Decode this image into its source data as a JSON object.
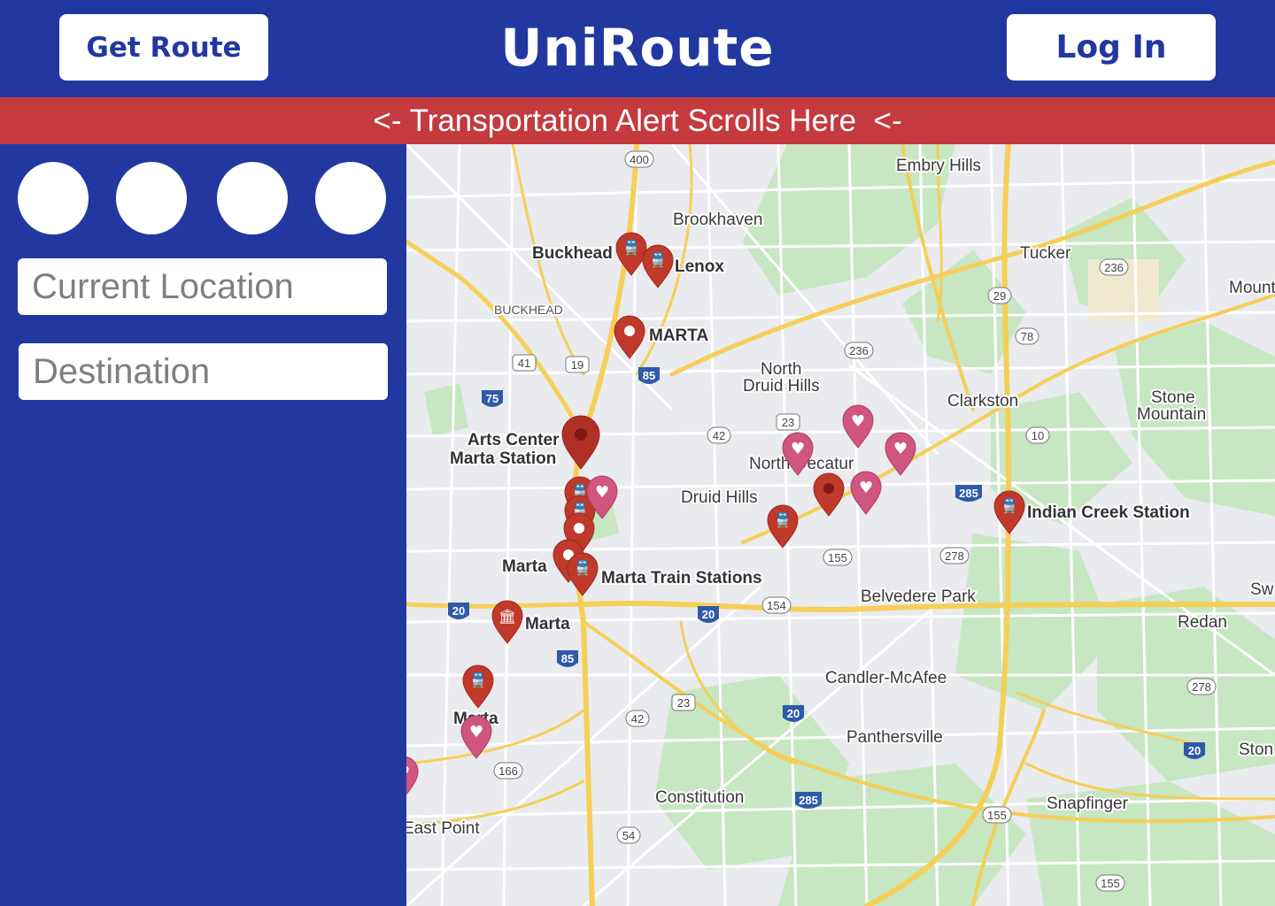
{
  "header": {
    "get_route_label": "Get Route",
    "title": "UniRoute",
    "login_label": "Log In"
  },
  "alert": {
    "text": "<- Transportation Alert Scrolls Here  <-"
  },
  "sidebar": {
    "current_location_placeholder": "Current Location",
    "destination_placeholder": "Destination"
  },
  "map": {
    "places": {
      "embry_hills": "Embry Hills",
      "brookhaven": "Brookhaven",
      "buckhead": "Buckhead",
      "lenox": "Lenox",
      "buckhead_area": "BUCKHEAD",
      "marta_top": "MARTA",
      "tucker": "Tucker",
      "mount": "Mount",
      "north_druid_hills_1": "North",
      "north_druid_hills_2": "Druid Hills",
      "clarkston": "Clarkston",
      "stone_mountain_1": "Stone",
      "stone_mountain_2": "Mountain",
      "arts_center_1": "Arts Center",
      "arts_center_2": "Marta Station",
      "north_decatur": "North Decatur",
      "druid_hills": "Druid Hills",
      "indian_creek": "Indian Creek Station",
      "marta_mid": "Marta",
      "marta_train_stations": "Marta Train Stations",
      "belvedere_park": "Belvedere Park",
      "marta_museum": "Marta",
      "redan": "Redan",
      "sw": "Sw",
      "candler_mcafee": "Candler-McAfee",
      "marta_low": "Marta",
      "panthersville": "Panthersville",
      "ston": "Ston",
      "constitution": "Constitution",
      "snapfinger": "Snapfinger",
      "east_point": "East Point"
    },
    "shields": {
      "r400": "400",
      "r236a": "236",
      "r29": "29",
      "r78": "78",
      "r236b": "236",
      "r41": "41",
      "r19": "19",
      "r85a": "85",
      "r75": "75",
      "r23a": "23",
      "r42a": "42",
      "r10": "10",
      "r285a": "285",
      "r155a": "155",
      "r278a": "278",
      "r20a": "20",
      "r20b": "20",
      "r154": "154",
      "r85b": "85",
      "r278b": "278",
      "r23b": "23",
      "r42b": "42",
      "r20c": "20",
      "r20d": "20",
      "r166": "166",
      "r285b": "285",
      "r155b": "155",
      "r54": "54",
      "r155c": "155"
    },
    "colors": {
      "land": "#e9ebee",
      "park": "#c7e6c2",
      "highway": "#f5cf58",
      "road": "#ffffff",
      "pin_red": "#c0392b",
      "pin_pink": "#d0557f"
    }
  }
}
